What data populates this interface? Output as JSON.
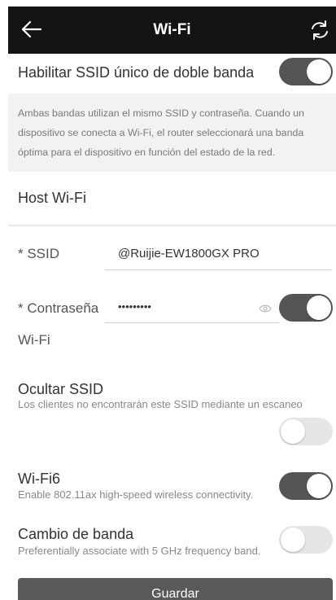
{
  "header": {
    "title": "Wi-Fi",
    "back_icon": "arrow-left-icon",
    "refresh_icon": "refresh-icon"
  },
  "dual_band": {
    "label": "Habilitar SSID único de doble banda",
    "enabled": true,
    "info": "Ambas bandas utilizan el mismo SSID y contraseña. Cuando un dispositivo se conecta a Wi-Fi, el router seleccionará una banda óptima para el dispositivo en función del estado de la red."
  },
  "section_title": "Host Wi-Fi",
  "ssid": {
    "label": "* SSID",
    "value": "@Ruijie-EW1800GX PRO"
  },
  "password": {
    "label": "* Contraseña",
    "label_cont": "Wi-Fi",
    "value": "•••••••••",
    "eye_icon": "eye-icon",
    "enabled": true
  },
  "hide_ssid": {
    "label": "Ocultar SSID",
    "description": "Los clientes no encontrarán este SSID mediante un escaneo",
    "enabled": false
  },
  "wifi6": {
    "label": "Wi-Fi6",
    "description": "Enable 802.11ax high-speed wireless connectivity.",
    "enabled": true
  },
  "band_steering": {
    "label": "Cambio de banda",
    "description": "Preferentially associate with 5 GHz frequency band.",
    "enabled": false
  },
  "save_label": "Guardar",
  "colors": {
    "header_bg": "#141414",
    "toggle_on": "#555555",
    "toggle_off": "#e6e6e6",
    "button_bg": "#595959"
  }
}
